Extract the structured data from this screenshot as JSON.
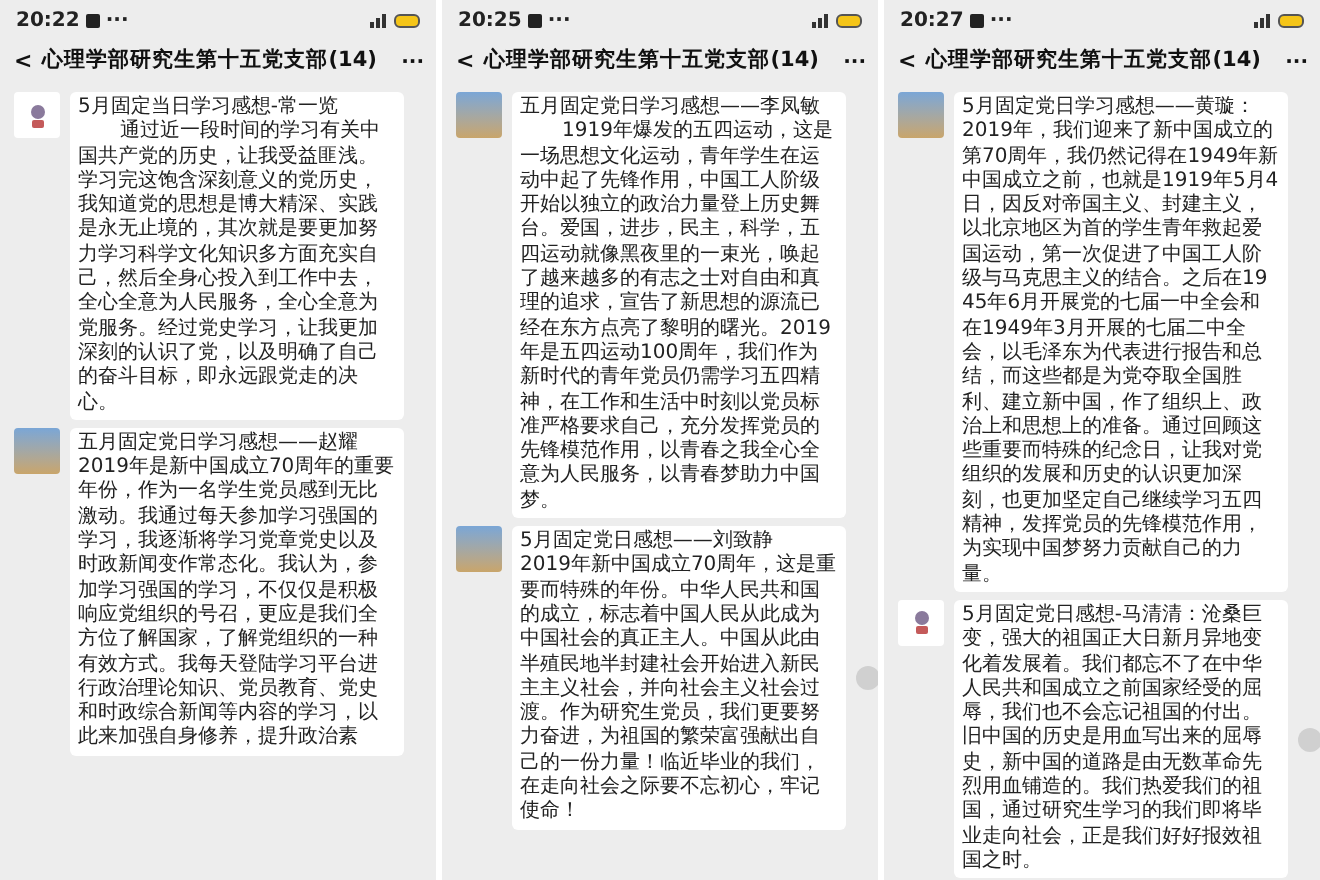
{
  "panels": [
    {
      "status_bar": {
        "time": "20:22",
        "dots": "···"
      },
      "header": {
        "back": "<",
        "title": "心理学部研究生第十五党支部(14)"
      },
      "messages": [
        {
          "kind": "cartoon",
          "share": false,
          "title": "5月固定当日学习感想-常一览",
          "indent": true,
          "body": "通过近一段时间的学习有关中国共产党的历史，让我受益匪浅。学习完这饱含深刻意义的党历史，我知道党的思想是博大精深、实践是永无止境的，其次就是要更加努力学习科学文化知识多方面充实自己，然后全身心投入到工作中去，全心全意为人民服务，全心全意为党服务。经过党史学习，让我更加深刻的认识了党，以及明确了自己的奋斗目标，即永远跟党走的决心。"
        },
        {
          "kind": "photo",
          "share": false,
          "title": "五月固定党日学习感想——赵耀",
          "indent": false,
          "body": "2019年是新中国成立70周年的重要年份，作为一名学生党员感到无比激动。我通过每天参加学习强国的学习，我逐渐将学习党章党史以及时政新闻变作常态化。我认为，参加学习强国的学习，不仅仅是积极响应党组织的号召，更应是我们全方位了解国家，了解党组织的一种有效方式。我每天登陆学习平台进行政治理论知识、党员教育、党史和时政综合新闻等内容的学习，以此来加强自身修养，提升政治素"
        }
      ]
    },
    {
      "status_bar": {
        "time": "20:25",
        "dots": "···"
      },
      "header": {
        "back": "<",
        "title": "心理学部研究生第十五党支部(14)"
      },
      "messages": [
        {
          "kind": "photo",
          "share": false,
          "title": "五月固定党日学习感想——李凤敏",
          "indent": true,
          "body": "1919年爆发的五四运动，这是一场思想文化运动，青年学生在运动中起了先锋作用，中国工人阶级开始以独立的政治力量登上历史舞台。爱国，进步，民主，科学，五四运动就像黑夜里的一束光，唤起了越来越多的有志之士对自由和真理的追求，宣告了新思想的源流已经在东方点亮了黎明的曙光。2019年是五四运动100周年，我们作为新时代的青年党员仍需学习五四精神，在工作和生活中时刻以党员标准严格要求自己，充分发挥党员的先锋模范作用，以青春之我全心全意为人民服务，以青春梦助力中国梦。"
        },
        {
          "kind": "photo",
          "share": true,
          "title": "5月固定党日感想——刘致静",
          "indent": false,
          "body": "2019年新中国成立70周年，这是重要而特殊的年份。中华人民共和国的成立，标志着中国人民从此成为中国社会的真正主人。中国从此由半殖民地半封建社会开始进入新民主主义社会，并向社会主义社会过渡。作为研究生党员，我们更要努力奋进，为祖国的繁荣富强献出自己的一份力量！临近毕业的我们，在走向社会之际要不忘初心，牢记使命！"
        }
      ]
    },
    {
      "status_bar": {
        "time": "20:27",
        "dots": "···"
      },
      "header": {
        "back": "<",
        "title": "心理学部研究生第十五党支部(14)"
      },
      "messages": [
        {
          "kind": "photo",
          "share": false,
          "title": "5月固定党日学习感想——黄璇：",
          "indent": false,
          "body": "2019年，我们迎来了新中国成立的第70周年，我仍然记得在1949年新中国成立之前，也就是1919年5月4日，因反对帝国主义、封建主义，以北京地区为首的学生青年救起爱国运动，第一次促进了中国工人阶级与马克思主义的结合。之后在1945年6月开展党的七届一中全会和在1949年3月开展的七届二中全会，以毛泽东为代表进行报告和总结，而这些都是为党夺取全国胜利、建立新中国，作了组织上、政治上和思想上的准备。通过回顾这些重要而特殊的纪念日，让我对党组织的发展和历史的认识更加深刻，也更加坚定自己继续学习五四精神，发挥党员的先锋模范作用，为实现中国梦努力贡献自己的力量。"
        },
        {
          "kind": "cartoon",
          "share": true,
          "title": "5月固定党日感想-马清清：沧桑巨变，强大的祖国正大日新月异地变化着发展着。我们都忘不了在中华人民共和国成立之前国家经受的屈辱，我们也不会忘记祖国的付出。旧中国的历史是用血写出来的屈辱史，新中国的道路是由无数革命先烈用血铺造的。我们热爱我们的祖国，通过研究生学习的我们即将毕业走向社会，正是我们好好报效祖国之时。"
        }
      ]
    }
  ]
}
